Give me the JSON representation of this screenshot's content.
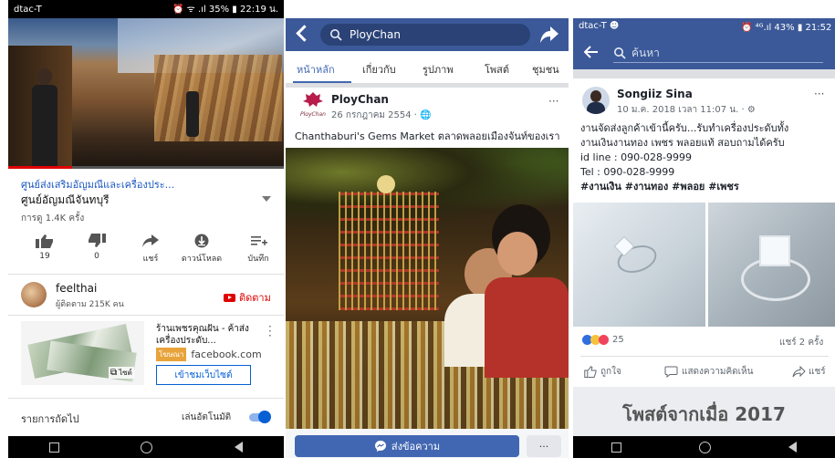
{
  "youtube": {
    "status_carrier": "dtac-T",
    "status_right": "⏰ ᯤ .ıl 35% ▮ 22:19 น.",
    "video_title": "ศูนย์ส่งเสริมอัญมณีและเครื่องประ...",
    "channel_heading": "ศูนย์อัญมณีจันทบุรี",
    "views": "การดู 1.4K ครั้ง",
    "actions": [
      {
        "label": "19"
      },
      {
        "label": "0"
      },
      {
        "label": "แชร์"
      },
      {
        "label": "ดาวน์โหลด"
      },
      {
        "label": "บันทึก"
      }
    ],
    "channel_name": "feelthai",
    "subscribers": "ผู้ติดตาม 215K คน",
    "subscribe_label": "ติดตาม",
    "ad_title": "ร้านเพชรคุณฝัน - ค้าส่งเครื่องประดับ...",
    "ad_badge": "โฆษณา",
    "ad_domain": "facebook.com",
    "ad_site_label": "ไซต์",
    "ad_button": "เข้าชมเว็บไซต์",
    "up_next": "รายการถัดไป",
    "autoplay": "เล่นอัตโนมัติ",
    "colors": {
      "red": "#e00000",
      "blue": "#065fd4"
    }
  },
  "fbpage": {
    "search_value": "PloyChan",
    "tabs": [
      "หน้าหลัก",
      "เกี่ยวกับ",
      "รูปภาพ",
      "โพสต์",
      "ชุมชน"
    ],
    "page_name": "PloyChan",
    "logo_text": "PloyChan",
    "post_date": "26 กรกฎาคม 2554 · 🌐",
    "post_text": "Chanthaburi's Gems Market ตลาดพลอยเมืองจันท์ของเรา",
    "message_button": "ส่งข้อความ",
    "more_label": "···",
    "colors": {
      "header": "#3b5998",
      "accent": "#4267b2"
    }
  },
  "fbsearch": {
    "status_carrier": "dtac-T ☻",
    "status_right": "⏰ ⁴ᴳ.ıl 43% ▮ 21:52 น.",
    "search_placeholder": "ค้นหา",
    "user_name": "Songiiz Sina",
    "post_date": "10 ม.ค. 2018 เวลา 11:07 น. · ⚙",
    "body_lines": [
      "งานจัดส่งลูกค้าเข้านี้ครับ...รับทำเครื่องประดับทั้ง",
      "งานเงินงานทอง เพชร พลอยแท้ สอบถามได้ครับ",
      "id line : 090-028-9999",
      "Tel : 090-028-9999"
    ],
    "hashtags": "#งานเงิน #งานทอง #พลอย #เพชร",
    "reaction_count": "25",
    "shares": "แชร์ 2 ครั้ง",
    "like_label": "ถูกใจ",
    "comment_label": "แสดงความคิดเห็น",
    "share_label": "แชร์",
    "footer_banner": "โพสต์จากเมื่อ 2017",
    "colors": {
      "header": "#3b5998"
    }
  }
}
